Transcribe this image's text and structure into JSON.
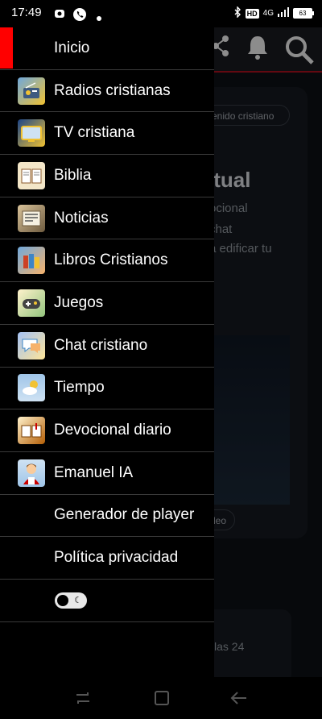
{
  "status_bar": {
    "time": "17:49",
    "hd": "HD",
    "network": "4G",
    "battery": "63"
  },
  "background": {
    "chip_text": "enido cristiano",
    "heading": "itual",
    "lines": [
      "ocional",
      "chat",
      "a edificar tu"
    ],
    "video_chip": "deo",
    "small_text": "las 24"
  },
  "drawer": {
    "items": [
      {
        "label": "Inicio",
        "icon": "home-icon"
      },
      {
        "label": "Radios cristianas",
        "icon": "radio-icon"
      },
      {
        "label": "TV cristiana",
        "icon": "tv-icon"
      },
      {
        "label": "Biblia",
        "icon": "bible-icon"
      },
      {
        "label": "Noticias",
        "icon": "news-icon"
      },
      {
        "label": "Libros Cristianos",
        "icon": "books-icon"
      },
      {
        "label": "Juegos",
        "icon": "games-icon"
      },
      {
        "label": "Chat cristiano",
        "icon": "chat-icon"
      },
      {
        "label": "Tiempo",
        "icon": "weather-icon"
      },
      {
        "label": "Devocional diario",
        "icon": "devotional-icon"
      },
      {
        "label": "Emanuel IA",
        "icon": "emanuel-icon"
      },
      {
        "label": "Generador de player",
        "icon": ""
      },
      {
        "label": "Política privacidad",
        "icon": ""
      }
    ],
    "theme_toggle_icon": "moon-icon"
  },
  "colors": {
    "accent": "#ff0000",
    "brand_red": "#b3121f"
  }
}
